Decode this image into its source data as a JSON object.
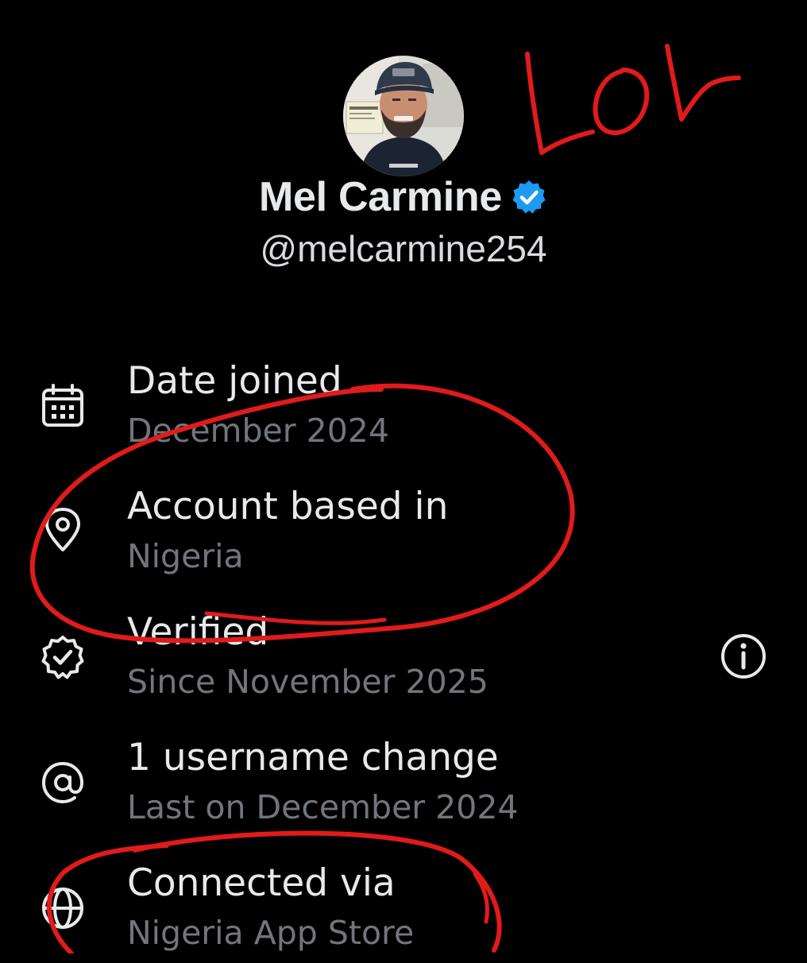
{
  "profile": {
    "display_name": "Mel Carmine",
    "handle": "@melcarmine254",
    "verified_icon": "verified-badge-icon",
    "badge_color": "#1d9bf0"
  },
  "details": [
    {
      "icon": "calendar-icon",
      "title": "Date joined",
      "subtitle": "December 2024"
    },
    {
      "icon": "location-pin-icon",
      "title": "Account based in",
      "subtitle": "Nigeria"
    },
    {
      "icon": "verified-outline-icon",
      "title": "Verified",
      "subtitle": "Since November 2025",
      "info_icon": "info-icon"
    },
    {
      "icon": "at-sign-icon",
      "title": "1 username change",
      "subtitle": "Last on December 2024"
    },
    {
      "icon": "globe-icon",
      "title": "Connected via",
      "subtitle": "Nigeria App Store"
    }
  ],
  "annotation": {
    "text": "LOL",
    "ink_color": "#e11b1b"
  },
  "colors": {
    "background": "#000000",
    "primary_text": "#e7e9ea",
    "secondary_text": "#71767b"
  }
}
